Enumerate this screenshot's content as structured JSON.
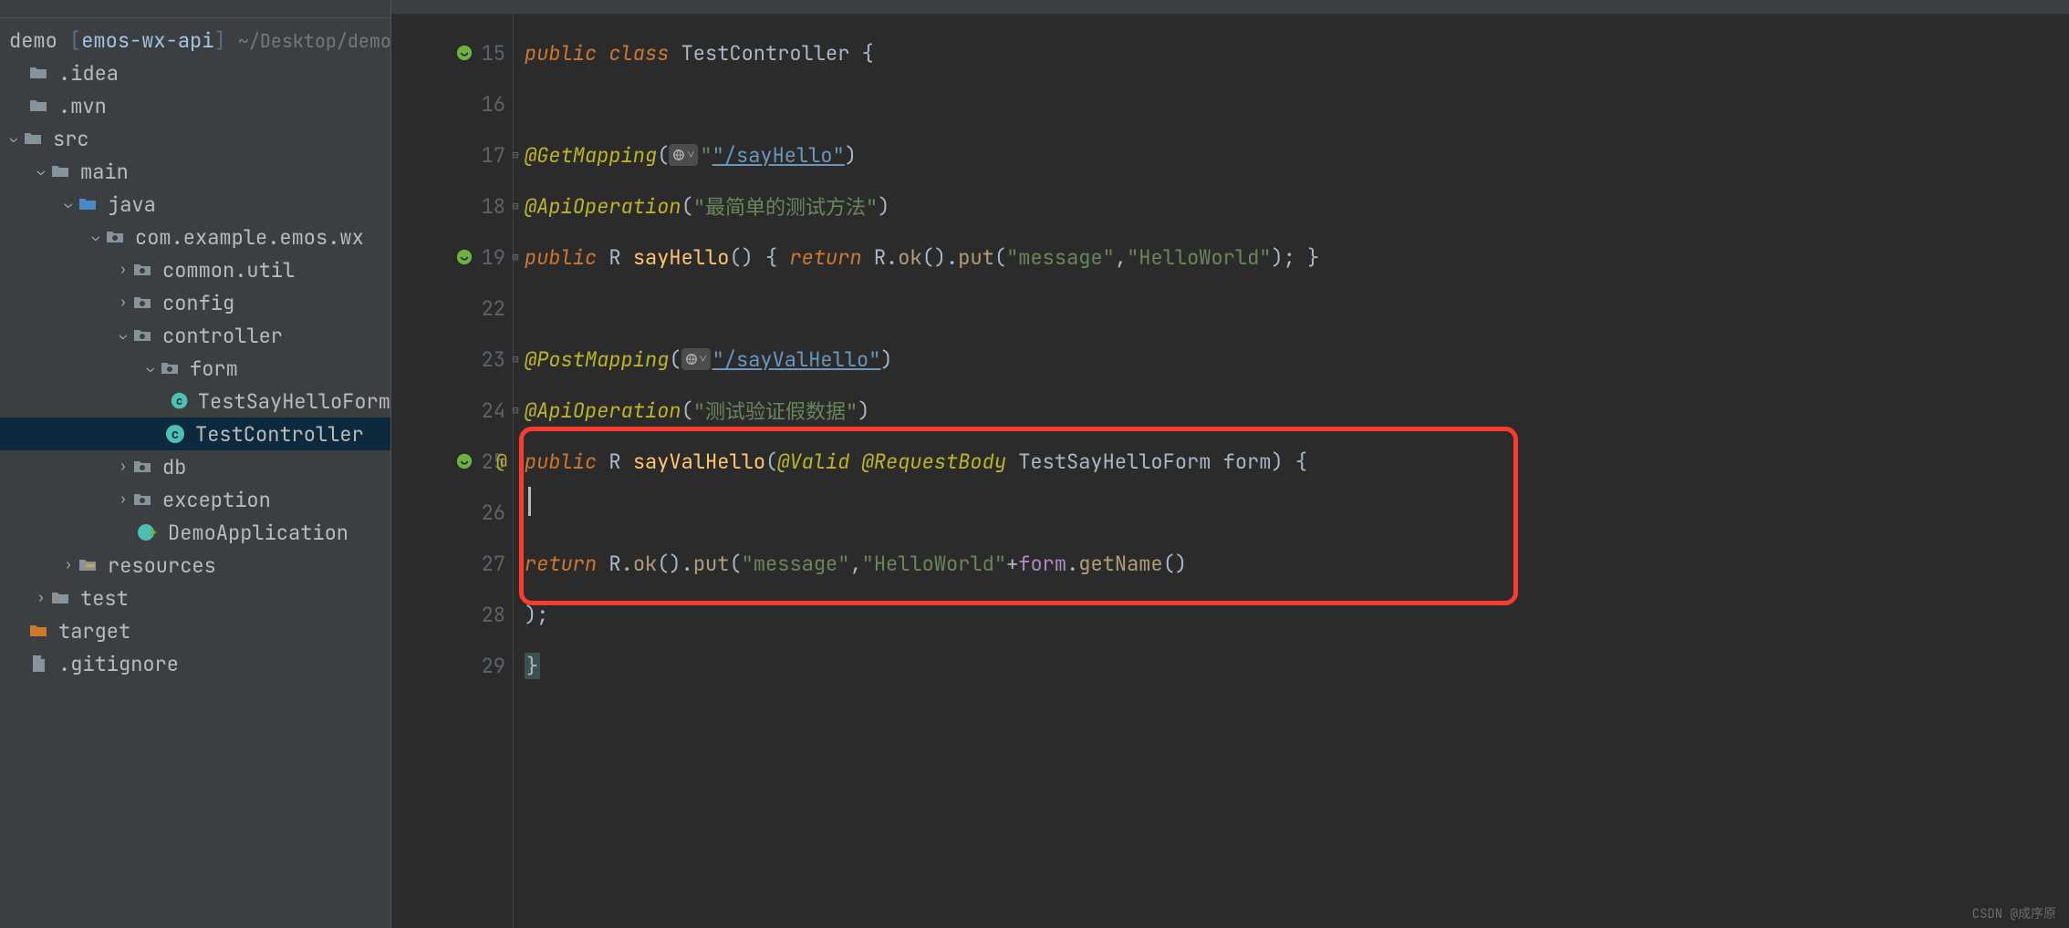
{
  "project": {
    "root_name": "demo",
    "module": "emos-wx-api",
    "path_hint": "~/Desktop/demo"
  },
  "tree": {
    "idea": ".idea",
    "mvn": ".mvn",
    "src": "src",
    "main": "main",
    "java": "java",
    "pkg": "com.example.emos.wx",
    "common_util": "common.util",
    "config": "config",
    "controller": "controller",
    "form": "form",
    "test_form": "TestSayHelloForm",
    "test_controller": "TestController",
    "db": "db",
    "exception": "exception",
    "demo_app": "DemoApplication",
    "resources": "resources",
    "test": "test",
    "target": "target",
    "gitignore": ".gitignore"
  },
  "gutter_lines": [
    "15",
    "16",
    "17",
    "18",
    "19",
    "22",
    "23",
    "24",
    "25",
    "26",
    "27",
    "28",
    "29"
  ],
  "code": {
    "l15": {
      "kw": "public class ",
      "cls": "TestController",
      "brace": " {"
    },
    "l17": {
      "ann": "@GetMapping",
      "open": "(",
      "url": "\"/sayHello\"",
      "close": ")"
    },
    "l18": {
      "ann": "@ApiOperation",
      "open": "(",
      "str": "\"最简单的测试方法\"",
      "close": ")"
    },
    "l19": {
      "kw": "public ",
      "ret": "R ",
      "name": "sayHello",
      "p": "() { ",
      "kw2": "return ",
      "r": "R",
      "dot1": ".",
      "m1": "ok",
      "p1": "().",
      "m2": "put",
      "p2": "(",
      "s1": "\"message\"",
      "c": ",",
      "s2": "\"HelloWorld\"",
      "end": "); }"
    },
    "l23": {
      "ann": "@PostMapping",
      "open": "(",
      "url": "\"/sayValHello\"",
      "close": ")"
    },
    "l24": {
      "ann": "@ApiOperation",
      "open": "(",
      "str": "\"测试验证假数据\"",
      "close": ")"
    },
    "l25": {
      "kw": "public ",
      "ret": "R ",
      "name": "sayValHello",
      "open": "(",
      "ann1": "@Valid ",
      "ann2": "@RequestBody ",
      "type": "TestSayHelloForm ",
      "param": "form",
      "close": ") {"
    },
    "l27": {
      "kw": "return ",
      "r": "R",
      "dot": ".",
      "m1": "ok",
      "p1": "().",
      "m2": "put",
      "p2": "(",
      "s1": "\"message\"",
      "c": ",",
      "s2": "\"HelloWorld\"",
      "plus": "+",
      "param": "form",
      "dot2": ".",
      "m3": "getName",
      "p3": "()"
    },
    "l28": {
      "close": ");"
    },
    "l29": {
      "brace": "}"
    }
  },
  "watermark": "CSDN @成序原"
}
